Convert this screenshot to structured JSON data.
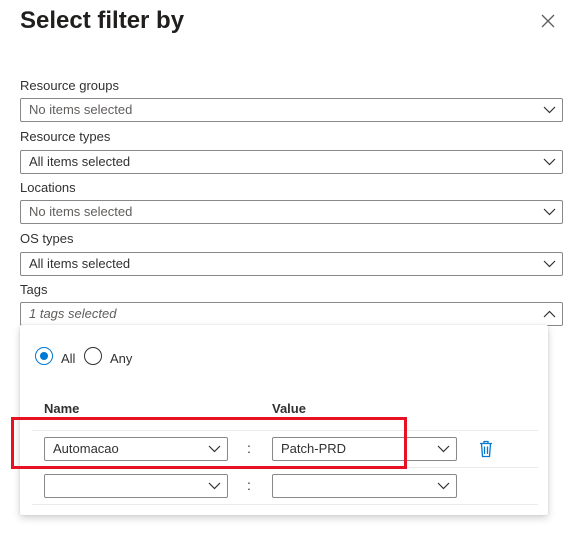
{
  "dialog": {
    "title": "Select filter by"
  },
  "filters": {
    "resource_groups": {
      "label": "Resource groups",
      "value": "No items selected"
    },
    "resource_types": {
      "label": "Resource types",
      "value": "All items selected"
    },
    "locations": {
      "label": "Locations",
      "value": "No items selected"
    },
    "os_types": {
      "label": "OS types",
      "value": "All items selected"
    },
    "tags": {
      "label": "Tags",
      "value": "1 tags selected"
    }
  },
  "tags_panel": {
    "match": {
      "options": [
        "All",
        "Any"
      ],
      "selected": "All"
    },
    "columns": {
      "name": "Name",
      "value": "Value"
    },
    "separator": ":",
    "rows": [
      {
        "name": "Automacao",
        "value": "Patch-PRD"
      },
      {
        "name": "",
        "value": ""
      }
    ]
  },
  "colors": {
    "accent": "#0078d4",
    "highlight": "#e81123",
    "delete_icon": "#0078d4"
  }
}
